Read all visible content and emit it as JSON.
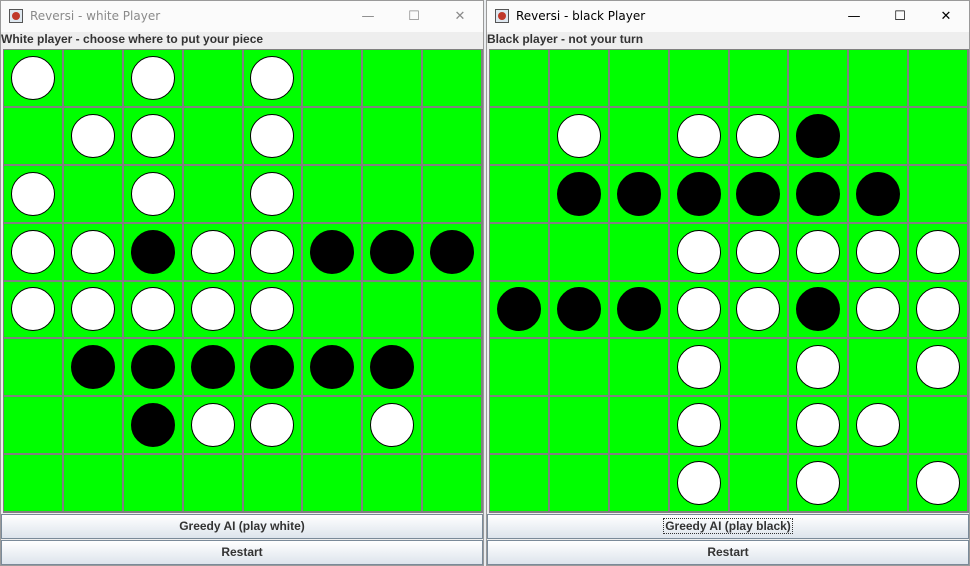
{
  "windows": [
    {
      "id": "white",
      "title": "Reversi - white Player",
      "status": "White player - choose where to put your piece",
      "ai_button": "Greedy AI (play white)",
      "restart_button": "Restart",
      "board": [
        "W.W.W...",
        ".WW.W...",
        "W.W.W...",
        "WWBWWBBB",
        "WWWWW...",
        ".BBBBBB.",
        "..BWW.W.",
        "........"
      ]
    },
    {
      "id": "black",
      "title": "Reversi - black Player",
      "status": "Black player - not your turn",
      "ai_button": "Greedy AI (play black)",
      "restart_button": "Restart",
      "board": [
        "........",
        ".W.WWB..",
        ".BBBBBB.",
        "...WWWWW",
        "BBBWWBWW",
        "...W.W.W",
        "...W.WW.",
        "...W.W.W"
      ]
    }
  ],
  "titlebar_controls": {
    "minimize": "—",
    "maximize": "☐",
    "close": "✕"
  },
  "colors": {
    "board": "#00ff00",
    "grid": "#808080",
    "white_piece": "#ffffff",
    "black_piece": "#000000"
  },
  "icons": [
    "java-app-icon",
    "minimize-icon",
    "maximize-icon",
    "close-icon"
  ]
}
